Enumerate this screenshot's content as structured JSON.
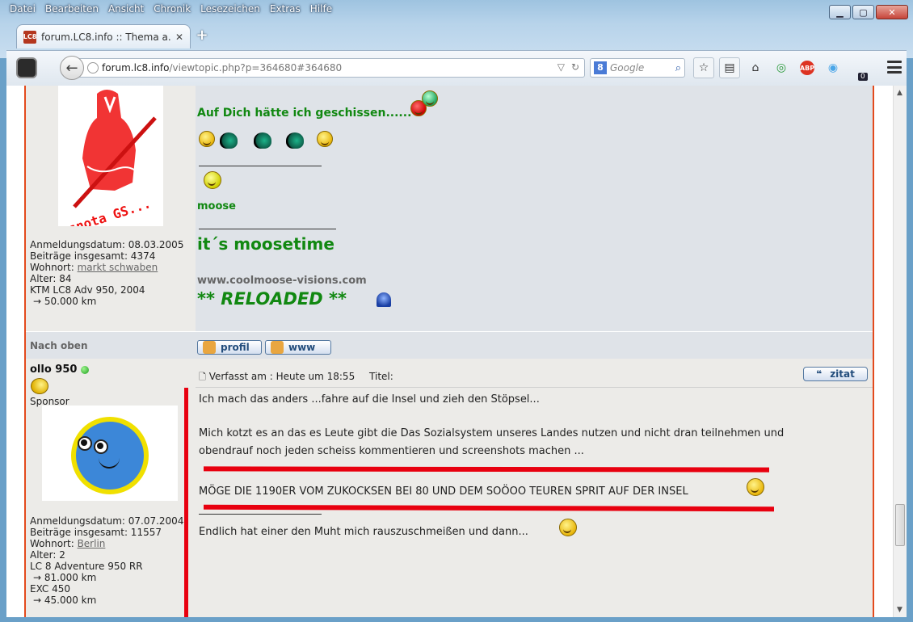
{
  "menu": [
    "Datei",
    "Bearbeiten",
    "Ansicht",
    "Chronik",
    "Lesezeichen",
    "Extras",
    "Hilfe"
  ],
  "tab": {
    "title": "forum.LC8.info :: Thema a...",
    "favicon_text": "LC8"
  },
  "url": {
    "host": "forum.lc8.info",
    "path": "/viewtopic.php?p=364680#364680"
  },
  "search": {
    "engine": "8",
    "placeholder": "Google"
  },
  "ghost_badge": "0",
  "post1": {
    "signature": {
      "line1": "Auf Dich hätte ich geschissen......",
      "moose": "moose",
      "moosetime": "it´s moosetime",
      "website": "www.coolmoose-visions.com",
      "reloaded": "** RELOADED **"
    },
    "avatar_text": "snota GS...",
    "profile": {
      "registered": "Anmeldungsdatum: 08.03.2005",
      "posts": "Beiträge insgesamt: 4374",
      "location_label": "Wohnort: ",
      "location": "markt schwaben",
      "age": "Alter: 84",
      "bike": "KTM LC8 Adv 950, 2004",
      "km": "→  50.000 km"
    }
  },
  "row_nav": {
    "to_top": "Nach oben",
    "profile_btn": "profil",
    "www_btn": "www"
  },
  "post2": {
    "author": "ollo 950",
    "rank": "Sponsor",
    "meta": "Verfasst am : Heute um 18:55",
    "title_label": "Titel:",
    "quote_btn": "zitat",
    "lines": [
      "Ich mach das anders ...fahre auf die Insel und zieh den Stöpsel...",
      "Mich kotzt es an das es Leute gibt die Das Sozialsystem unseres Landes nutzen und nicht dran teilnehmen und",
      "obendrauf noch jeden scheiss kommentieren und screenshots machen ...",
      "MÖGE DIE 1190ER VOM ZUKOCKSEN BEI 80 UND DEM SOÖOO TEUREN SPRIT AUF DER INSEL",
      "Endlich hat einer den Muht mich rauszuschmeißen und dann..."
    ],
    "profile": {
      "registered": "Anmeldungsdatum: 07.07.2004",
      "posts": "Beiträge insgesamt: 11557",
      "location_label": "Wohnort: ",
      "location": "Berlin",
      "age": "Alter: 2",
      "bike1": "LC 8 Adventure 950 RR",
      "km1": "→  81.000 km",
      "bike2": "EXC 450",
      "km2": "→  45.000 km"
    }
  },
  "colors": {
    "accent": "#e34a1d",
    "signature_green": "#118811",
    "highlight_red": "#e8000f"
  }
}
